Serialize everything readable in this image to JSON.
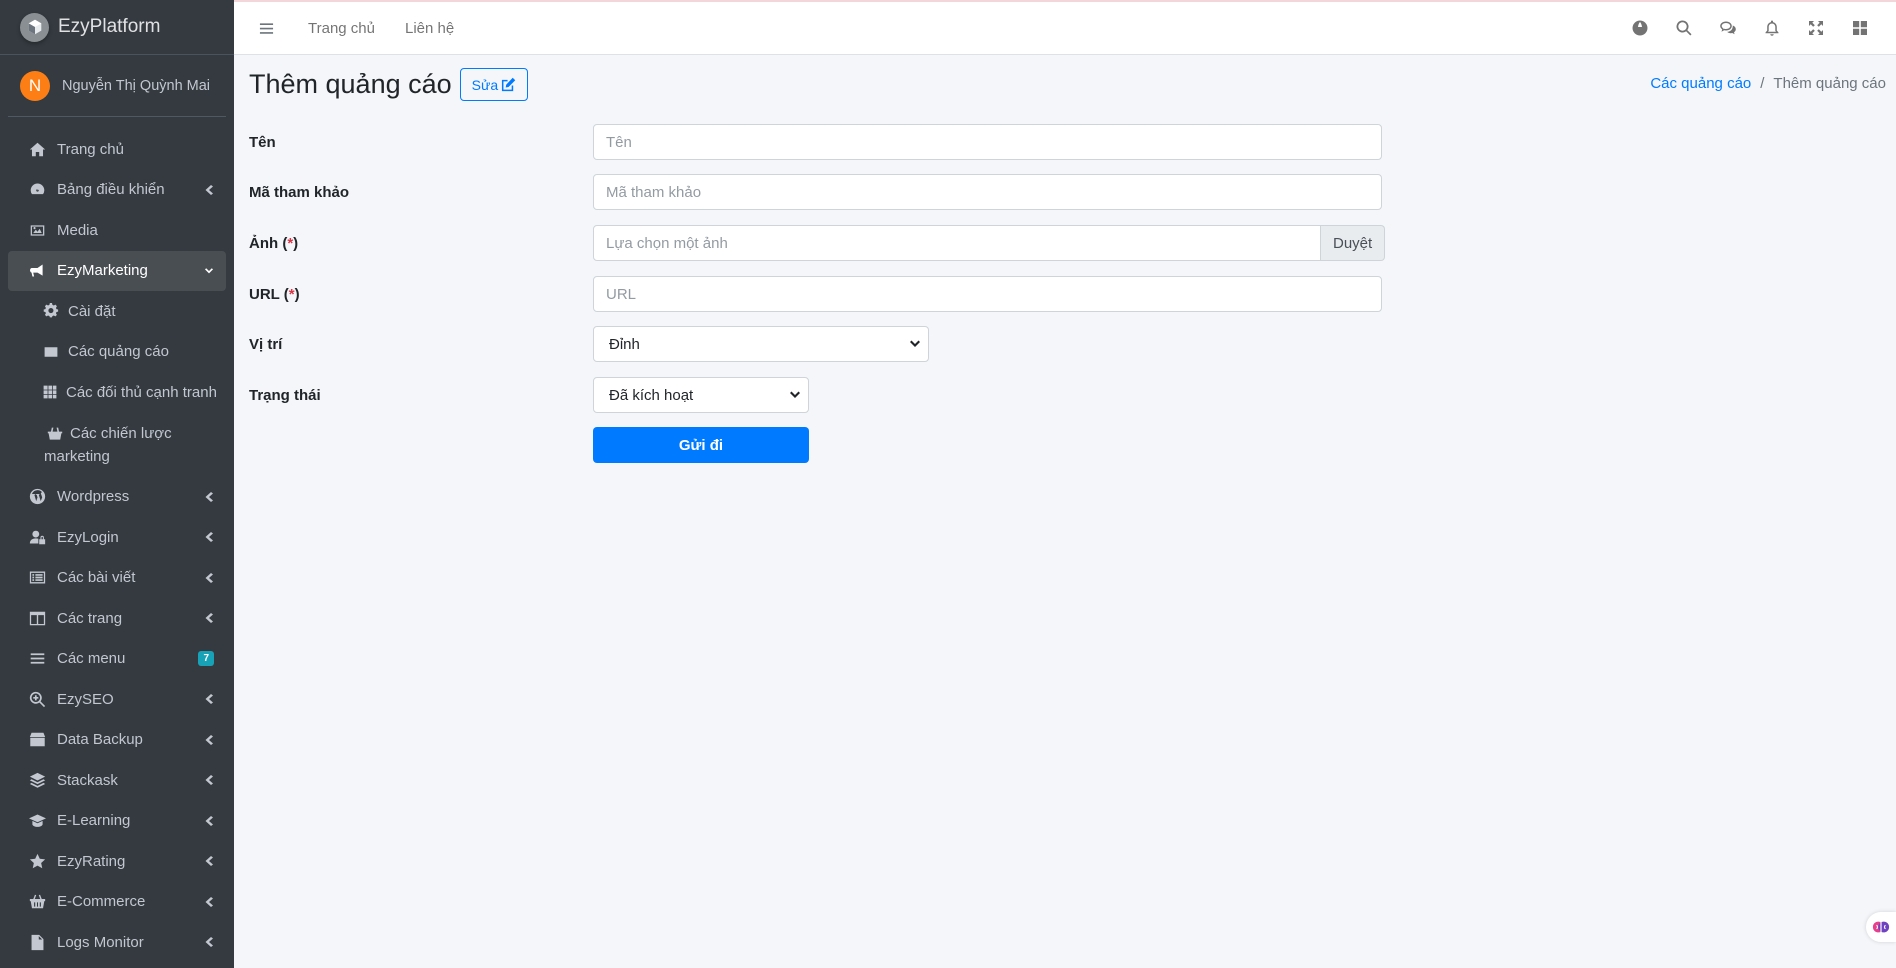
{
  "brand": {
    "name": "EzyPlatform"
  },
  "user": {
    "initial": "N",
    "name": "Nguyễn Thị Quỳnh Mai"
  },
  "sidebar": {
    "items": [
      {
        "label": "Trang chủ",
        "icon": "home-icon"
      },
      {
        "label": "Bảng điều khiển",
        "icon": "dashboard-icon"
      },
      {
        "label": "Media",
        "icon": "image-icon"
      },
      {
        "label": "EzyMarketing",
        "icon": "bullhorn-icon"
      },
      {
        "label": "Cài đặt",
        "icon": "gear-icon"
      },
      {
        "label": "Các quảng cáo",
        "icon": "ad-icon"
      },
      {
        "label": "Các đối thủ cạnh tranh",
        "icon": "grid-icon"
      },
      {
        "label": "Các chiến lược marketing",
        "icon": "basket-icon"
      },
      {
        "label": "Wordpress",
        "icon": "wordpress-icon"
      },
      {
        "label": "EzyLogin",
        "icon": "user-lock-icon"
      },
      {
        "label": "Các bài viết",
        "icon": "list-alt-icon"
      },
      {
        "label": "Các trang",
        "icon": "columns-icon"
      },
      {
        "label": "Các menu",
        "icon": "bars-icon",
        "badge": "7"
      },
      {
        "label": "EzySEO",
        "icon": "search-plus-icon"
      },
      {
        "label": "Data Backup",
        "icon": "box-icon"
      },
      {
        "label": "Stackask",
        "icon": "layers-icon"
      },
      {
        "label": "E-Learning",
        "icon": "graduation-cap-icon"
      },
      {
        "label": "EzyRating",
        "icon": "star-icon"
      },
      {
        "label": "E-Commerce",
        "icon": "shopping-basket-icon"
      },
      {
        "label": "Logs Monitor",
        "icon": "file-icon"
      }
    ]
  },
  "topbar": {
    "links": [
      "Trang chủ",
      "Liên hệ"
    ],
    "icons": [
      "globe-icon",
      "search-icon",
      "comments-icon",
      "bell-icon",
      "expand-icon",
      "apps-icon"
    ]
  },
  "page": {
    "title": "Thêm quảng cáo",
    "edit_label": "Sửa",
    "breadcrumb": {
      "parent": "Các quảng cáo",
      "separator": "/",
      "current": "Thêm quảng cáo"
    }
  },
  "form": {
    "name": {
      "label": "Tên",
      "placeholder": "Tên"
    },
    "ref": {
      "label": "Mã tham khảo",
      "placeholder": "Mã tham khảo"
    },
    "image": {
      "label": "Ảnh (",
      "req": "*",
      "label_end": ")",
      "placeholder": "Lựa chọn một ảnh",
      "browse": "Duyệt"
    },
    "url": {
      "label": "URL (",
      "req": "*",
      "label_end": ")",
      "placeholder": "URL"
    },
    "position": {
      "label": "Vị trí",
      "value": "Đỉnh"
    },
    "status": {
      "label": "Trạng thái",
      "value": "Đã kích hoạt"
    },
    "submit": "Gửi đi"
  },
  "colors": {
    "primary": "#007bff",
    "sidebar": "#343a40",
    "accent_avatar": "#fd7e14",
    "badge": "#17a2b8"
  }
}
